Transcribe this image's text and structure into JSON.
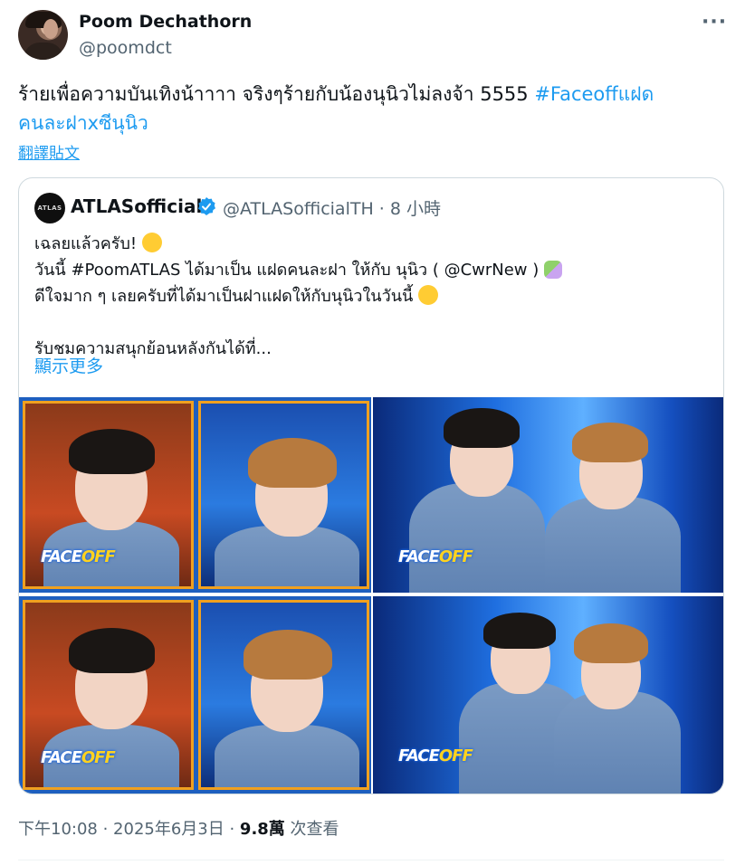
{
  "author": {
    "name": "Poom Dechathorn",
    "handle": "@poomdct"
  },
  "tweet": {
    "text": "ร้ายเพื่อความบันเทิงน้าาาา จริงๆร้ายกับน้องนุนิวไม่ลงจ้า 5555 ",
    "hashtag_1": "#Faceoffแฝด",
    "hashtag_2": "คนละฝาxซีนุนิว",
    "translate_label": "翻譯貼文"
  },
  "more_label": "···",
  "quote": {
    "avatar_text": "ATLAS",
    "name": "ATLASofficial",
    "handle_time": "@ATLASofficialTH · 8 小時",
    "line1": "เฉลยแล้วครับ!",
    "line2": "วันนี้ #PoomATLAS ได้มาเป็น แฝดคนละฝา ให้กับ นุนิว ( @CwrNew )",
    "line3": "ดีใจมาก ๆ เลยครับที่ได้มาเป็นฝาแฝดให้กับนุนิวในวันนี้",
    "line4": "รับชมความสนุกย้อนหลังกันได้ที่...",
    "show_more": "顯示更多",
    "verified_color": "#1d9bf0"
  },
  "media": {
    "logo_face": "FACE",
    "logo_off": "OFF"
  },
  "meta": {
    "time": "下午10:08 · 2025年6月3日 · ",
    "views_count": "9.8萬",
    "views_label": " 次查看"
  },
  "colors": {
    "link": "#1d9bf0",
    "secondary": "#536471",
    "panel_border": "#f0a01f"
  }
}
